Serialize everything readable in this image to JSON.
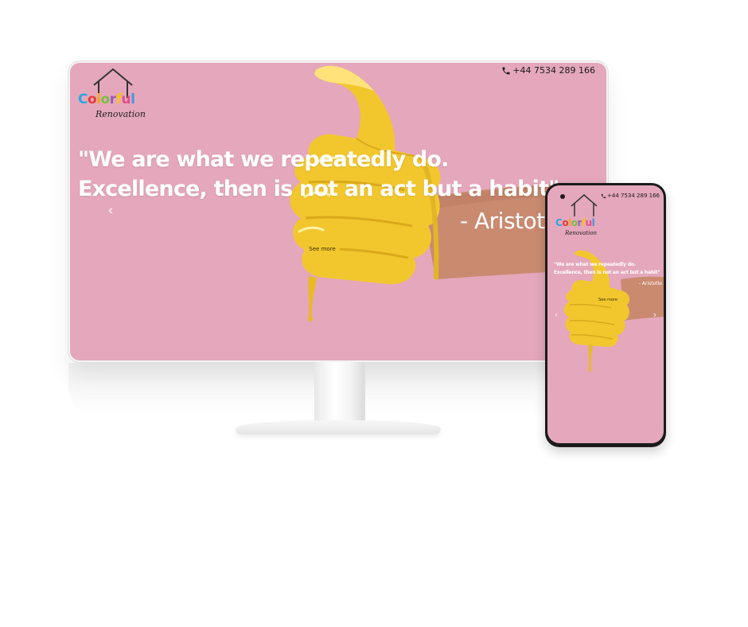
{
  "desktop": {
    "contact": {
      "phone": "+44 7534 289 166",
      "icon": "phone-icon"
    },
    "logo": {
      "word1_letters": [
        "C",
        "o",
        "l",
        "o",
        "r",
        "f",
        "u",
        "l"
      ],
      "word2": "Renovation",
      "letter_colors": [
        "#2aa8e0",
        "#e23b3b",
        "#f5a623",
        "#7bc043",
        "#9b59b6",
        "#f0c419",
        "#e74c8b",
        "#3a9ad9"
      ]
    },
    "hero": {
      "quote_line1": "\"We are what we repeatedly do.",
      "quote_line2": "Excellence, then is not an act but a habit\"",
      "author": "- Aristotle",
      "cta_label": "See more",
      "prev_label": "‹"
    }
  },
  "mobile": {
    "contact": {
      "phone": "+44 7534 289 166",
      "icon": "phone-icon"
    },
    "logo": {
      "word1_letters": [
        "C",
        "o",
        "l",
        "o",
        "r",
        "f",
        "u",
        "l"
      ],
      "word2": "Renovation"
    },
    "hero": {
      "quote_line1": "\"We are what we repeatedly do.",
      "quote_line2": "Excellence, then is not an act but a habit\"",
      "author": "- Aristotle",
      "cta_label": "See more",
      "prev_label": "‹",
      "next_label": "›"
    }
  },
  "colors": {
    "background_pink": "#e4a7bc",
    "paint_yellow": "#f2c72e",
    "skin": "#c98a70"
  }
}
